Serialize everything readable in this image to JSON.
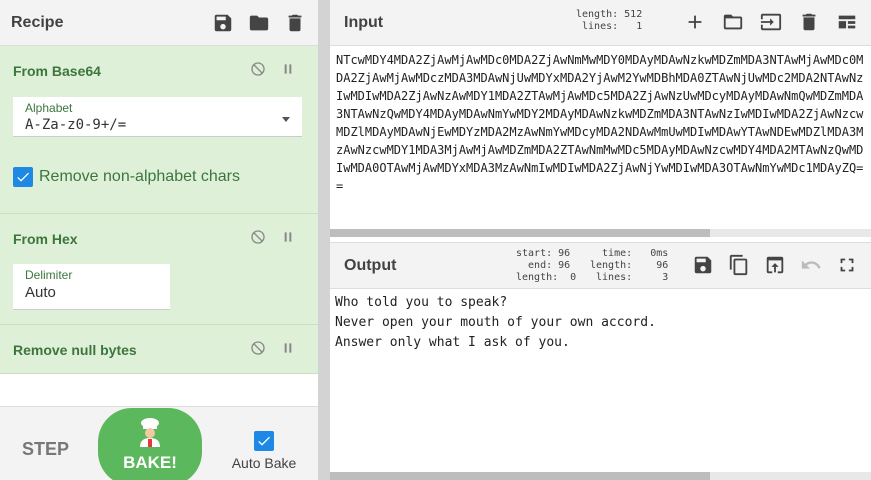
{
  "recipe": {
    "title": "Recipe",
    "operations": [
      {
        "name": "From Base64",
        "args": [
          {
            "label": "Alphabet",
            "value": "A-Za-z0-9+/="
          }
        ],
        "checkbox": {
          "label": "Remove non-alphabet chars",
          "checked": true
        }
      },
      {
        "name": "From Hex",
        "args": [
          {
            "label": "Delimiter",
            "value": "Auto"
          }
        ]
      },
      {
        "name": "Remove null bytes"
      }
    ],
    "step_label": "STEP",
    "bake_label": "BAKE!",
    "auto_bake_label": "Auto Bake",
    "auto_bake_checked": true
  },
  "input": {
    "title": "Input",
    "stats": "length: 512\n lines:   1",
    "text": "NTcwMDY4MDA2ZjAwMjAwMDc0MDA2ZjAwNmMwMDY0MDAyMDAwNzkwMDZmMDA3NTAwMjAwMDc0MDA2ZjAwMjAwMDczMDA3MDAwNjUwMDYxMDA2YjAwM2YwMDBhMDA0ZTAwNjUwMDc2MDA2NTAwNzIwMDIwMDA2ZjAwNzAwMDY1MDA2ZTAwMjAwMDc5MDA2ZjAwNzUwMDcyMDAyMDAwNmQwMDZmMDA3NTAwNzQwMDY4MDAyMDAwNmYwMDY2MDAyMDAwNzkwMDZmMDA3NTAwNzIwMDIwMDA2ZjAwNzcwMDZlMDAyMDAwNjEwMDYzMDA2MzAwNmYwMDcyMDA2NDAwMmUwMDIwMDAwYTAwNDEwMDZlMDA3MzAwNzcwMDY1MDA3MjAwMjAwMDZmMDA2ZTAwNmMwMDc5MDAyMDAwNzcwMDY4MDA2MTAwNzQwMDIwMDA0OTAwMjAwMDYxMDA3MzAwNmIwMDIwMDA2ZjAwNjYwMDIwMDA3OTAwNmYwMDc1MDAyZQ=="
  },
  "output": {
    "title": "Output",
    "stats_left": "start: 96\n  end: 96\nlength:  0",
    "stats_right": "  time:   0ms\nlength:    96\n lines:     3",
    "lines": [
      "Who told you to speak?",
      "Never open your mouth of your own accord.",
      "Answer only what I ask of you."
    ]
  },
  "colors": {
    "op_background": "#dff0d8",
    "op_text": "#3c763d",
    "bake_button": "#5cb85c",
    "checkbox": "#1e88e5"
  }
}
